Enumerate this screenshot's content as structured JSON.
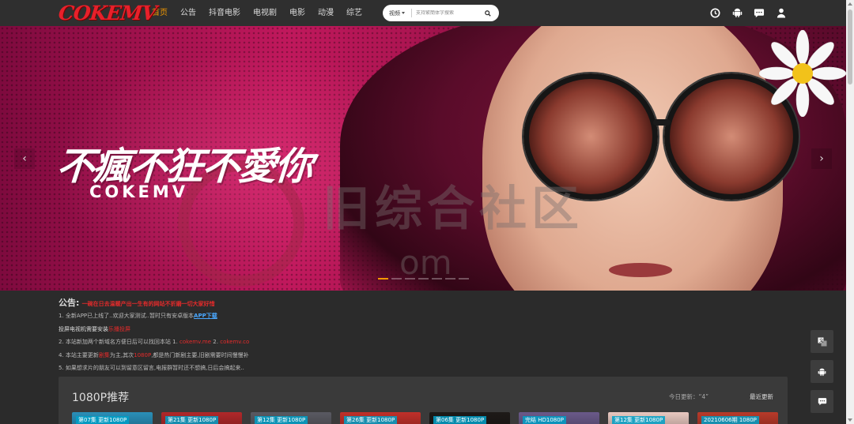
{
  "header": {
    "logo": "COKEMV",
    "nav": [
      {
        "label": "首页",
        "active": true
      },
      {
        "label": "公告",
        "active": false
      },
      {
        "label": "抖音电影",
        "active": false
      },
      {
        "label": "电视剧",
        "active": false
      },
      {
        "label": "电影",
        "active": false
      },
      {
        "label": "动漫",
        "active": false
      },
      {
        "label": "综艺",
        "active": false
      }
    ],
    "search": {
      "type": "视频",
      "placeholder": "支持繁簡体字搜索"
    },
    "icons": [
      "clock-icon",
      "android-icon",
      "chat-icon",
      "user-icon"
    ]
  },
  "banner": {
    "title": "不瘋不狂不愛你",
    "subtitle": "COKEMV",
    "watermark_cn": "旧综合社区",
    "watermark_domain": "om",
    "slides": 7,
    "active_slide": 0
  },
  "notice": {
    "label": "公告:",
    "headline": "一碗在日去温暖产出一生有的网站不折磨一切大家好惜",
    "line1_prefix": "1. 全新APP已上线了..欢迎大家测试..暂时只有安卓版本",
    "line1_link": "APP下载",
    "line2_prefix": "投屏电视机需要安装",
    "line2_red": "乐播投屏",
    "line3_prefix": "2. 本站新加两个新域名方便日后可以找回本站 1.",
    "line3_domain1": "cokemv.me",
    "line3_mid": "2.",
    "line3_domain2": "cokemv.co",
    "line4_prefix": "4. 本站主要更新",
    "line4_red1": "剧集",
    "line4_mid": "为主,其次",
    "line4_red2": "1080P",
    "line4_suffix": ",都是热门新剧主要,旧剧需要时间慢慢补",
    "line5": "5. 如果想求片的朋友可以到留意区留言,电报群暂时还不想搞,日后会搞起来.."
  },
  "section": {
    "title": "1080P推荐",
    "today_label": "今日更新：“4”",
    "more": "最近更新",
    "cards": [
      {
        "tag": "第07集 更新1080P",
        "color": "#2a8fb8"
      },
      {
        "tag": "第21集 更新1080P",
        "color": "#b0282a"
      },
      {
        "tag": "第12集 更新1080P",
        "color": "#5a5a62"
      },
      {
        "tag": "第26集 更新1080P",
        "color": "#c0302a"
      },
      {
        "tag": "第06集 更新1080P",
        "color": "#1e1a18"
      },
      {
        "tag": "完结 HD1080P",
        "color": "#6a5a8a"
      },
      {
        "tag": "第12集 更新1080P",
        "color": "#e8c8c0"
      },
      {
        "tag": "20210606期 1080P",
        "color": "#b83a2a"
      }
    ]
  },
  "tools": [
    "translate-icon",
    "android-icon",
    "chat-icon"
  ],
  "colors": {
    "accent": "#f39800",
    "red": "#e62b2b",
    "link": "#4aa8ff",
    "bg": "#2b2b2b"
  }
}
